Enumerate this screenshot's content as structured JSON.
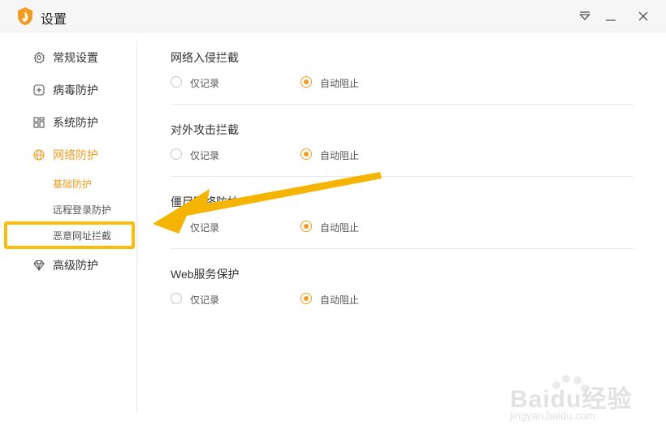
{
  "window": {
    "title": "设置",
    "controls": {
      "menu_icon": "dropdown-triangle-icon",
      "minimize_icon": "minimize-icon",
      "close_icon": "close-icon"
    }
  },
  "sidebar": {
    "items": [
      {
        "label": "常规设置",
        "icon": "gear-icon"
      },
      {
        "label": "病毒防护",
        "icon": "plus-box-icon"
      },
      {
        "label": "系统防护",
        "icon": "grid-icon"
      },
      {
        "label": "网络防护",
        "icon": "globe-icon",
        "active": true
      },
      {
        "label": "高级防护",
        "icon": "diamond-icon"
      }
    ],
    "network_subitems": [
      {
        "label": "基础防护",
        "active": true
      },
      {
        "label": "远程登录防护"
      },
      {
        "label": "恶意网址拦截",
        "highlighted": true
      }
    ]
  },
  "main": {
    "sections": [
      {
        "title": "网络入侵拦截",
        "options": [
          "仅记录",
          "自动阻止"
        ],
        "selected": "自动阻止"
      },
      {
        "title": "对外攻击拦截",
        "options": [
          "仅记录",
          "自动阻止"
        ],
        "selected": "自动阻止"
      },
      {
        "title": "僵尸网络防护",
        "options": [
          "仅记录",
          "自动阻止"
        ],
        "selected": "自动阻止"
      },
      {
        "title": "Web服务保护",
        "options": [
          "仅记录",
          "自动阻止"
        ],
        "selected": "自动阻止"
      }
    ]
  },
  "watermark": {
    "text": "Baidu经验",
    "url": "jingyan.baidu.com"
  },
  "colors": {
    "accent": "#f29c1f",
    "highlight": "#fbbd08",
    "titlebar": "#f6f6f6"
  }
}
